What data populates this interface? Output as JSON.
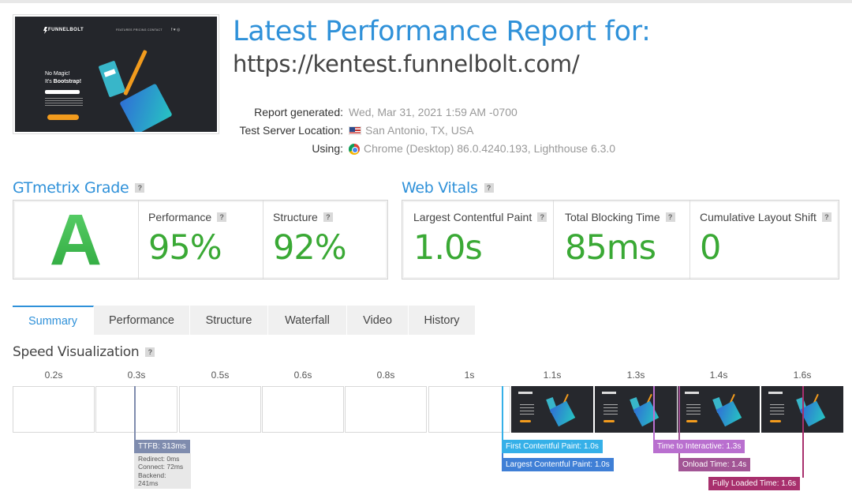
{
  "header": {
    "title": "Latest Performance Report for:",
    "url": "https://kentest.funnelbolt.com/"
  },
  "thumbnail": {
    "brand": "FUNNELBOLT",
    "nav": "FEATURES  PRICING  CONTACT",
    "social": "f ♥ ◎",
    "headline_line1": "No Magic!",
    "headline_line2_prefix": "It's ",
    "headline_line2_bold": "Bootstrap!"
  },
  "meta": {
    "report_generated_label": "Report generated:",
    "report_generated_value": "Wed, Mar 31, 2021 1:59 AM -0700",
    "server_label": "Test Server Location:",
    "server_value": "San Antonio, TX, USA",
    "using_label": "Using:",
    "using_value": "Chrome (Desktop) 86.0.4240.193, Lighthouse 6.3.0"
  },
  "grade_section": {
    "heading": "GTmetrix Grade",
    "grade": "A",
    "performance_label": "Performance",
    "performance_value": "95%",
    "structure_label": "Structure",
    "structure_value": "92%"
  },
  "vitals_section": {
    "heading": "Web Vitals",
    "lcp_label": "Largest Contentful Paint",
    "lcp_value": "1.0s",
    "tbt_label": "Total Blocking Time",
    "tbt_value": "85ms",
    "cls_label": "Cumulative Layout Shift",
    "cls_value": "0"
  },
  "tabs": [
    {
      "label": "Summary",
      "active": true
    },
    {
      "label": "Performance",
      "active": false
    },
    {
      "label": "Structure",
      "active": false
    },
    {
      "label": "Waterfall",
      "active": false
    },
    {
      "label": "Video",
      "active": false
    },
    {
      "label": "History",
      "active": false
    }
  ],
  "speed_viz": {
    "heading": "Speed Visualization",
    "ticks": [
      "0.2s",
      "0.3s",
      "0.5s",
      "0.6s",
      "0.8s",
      "1s",
      "1.1s",
      "1.3s",
      "1.4s",
      "1.6s"
    ],
    "frames_with_content": [
      false,
      false,
      false,
      false,
      false,
      false,
      true,
      true,
      true,
      true
    ],
    "markers": {
      "ttfb": "TTFB: 313ms",
      "redirect": "Redirect: 0ms",
      "connect": "Connect: 72ms",
      "backend": "Backend: 241ms",
      "fcp": "First Contentful Paint: 1.0s",
      "lcp": "Largest Contentful Paint: 1.0s",
      "tti": "Time to Interactive: 1.3s",
      "onload": "Onload Time: 1.4s",
      "fully_loaded": "Fully Loaded Time: 1.6s"
    },
    "colors": {
      "ttfb": "#7f8cae",
      "fcp": "#35b0e8",
      "lcp": "#3f7fd6",
      "tti": "#b96fcf",
      "onload": "#a25595",
      "fully_loaded": "#a8306d"
    }
  }
}
